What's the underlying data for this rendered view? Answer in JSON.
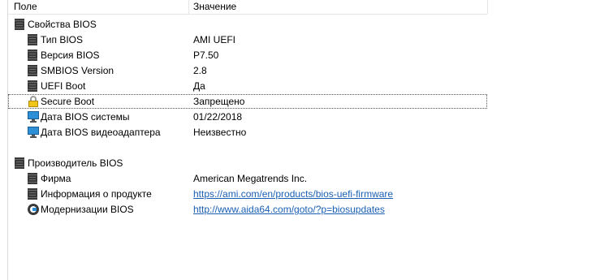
{
  "header": {
    "col_field": "Поле",
    "col_value": "Значение"
  },
  "groups": [
    {
      "title": "Свойства BIOS",
      "icon": "chip-icon",
      "items": [
        {
          "label": "Тип BIOS",
          "value": "AMI UEFI",
          "icon": "chip-icon"
        },
        {
          "label": "Версия BIOS",
          "value": "P7.50",
          "icon": "chip-icon"
        },
        {
          "label": "SMBIOS Version",
          "value": "2.8",
          "icon": "chip-icon"
        },
        {
          "label": "UEFI Boot",
          "value": "Да",
          "icon": "chip-icon"
        },
        {
          "label": "Secure Boot",
          "value": "Запрещено",
          "icon": "lock-icon",
          "selected": true
        },
        {
          "label": "Дата BIOS системы",
          "value": "01/22/2018",
          "icon": "monitor-icon"
        },
        {
          "label": "Дата BIOS видеоадаптера",
          "value": "Неизвестно",
          "icon": "monitor-icon"
        }
      ]
    },
    {
      "title": "Производитель BIOS",
      "icon": "chip-icon",
      "items": [
        {
          "label": "Фирма",
          "value": "American Megatrends Inc.",
          "icon": "chip-icon"
        },
        {
          "label": "Информация о продукте",
          "value": "https://ami.com/en/products/bios-uefi-firmware",
          "icon": "chip-icon",
          "link": true
        },
        {
          "label": "Модернизации BIOS",
          "value": "http://www.aida64.com/goto/?p=biosupdates",
          "icon": "update-icon",
          "link": true
        }
      ]
    }
  ],
  "colors": {
    "link": "#1a5fb4",
    "selection_outline": "#555555"
  }
}
